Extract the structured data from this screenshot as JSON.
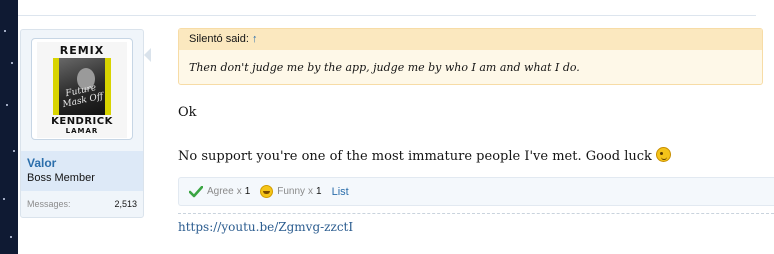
{
  "user": {
    "avatar": {
      "top_text": "REMIX",
      "script_text": "Future Mask Off",
      "bottom_text": "KENDRICK",
      "bottom_subtext": "LAMAR"
    },
    "username": "Valor",
    "title": "Boss Member",
    "stats": [
      {
        "label": "Messages:",
        "value": "2,513"
      }
    ]
  },
  "quote": {
    "author": "Silentó said:",
    "arrow": "↑",
    "text": "Then don't judge me by the app, judge me by who I am and what I do."
  },
  "message": {
    "line1": "Ok",
    "line2": "No support you're one of the most immature people I've met. Good luck"
  },
  "reactions": {
    "items": [
      {
        "name": "Agree",
        "times": "x",
        "count": "1",
        "icon": "checkmark-icon"
      },
      {
        "name": "Funny",
        "times": "x",
        "count": "1",
        "icon": "laughing-face-icon"
      }
    ],
    "list_label": "List"
  },
  "signature": {
    "link": "https://youtu.be/Zgmvg-zzctI"
  },
  "colors": {
    "link": "#2b6eab",
    "quote_bg": "#fef8e8",
    "quote_header": "#fbe8bf",
    "user_panel": "#dde9f7",
    "agree_check": "#3aa543"
  }
}
